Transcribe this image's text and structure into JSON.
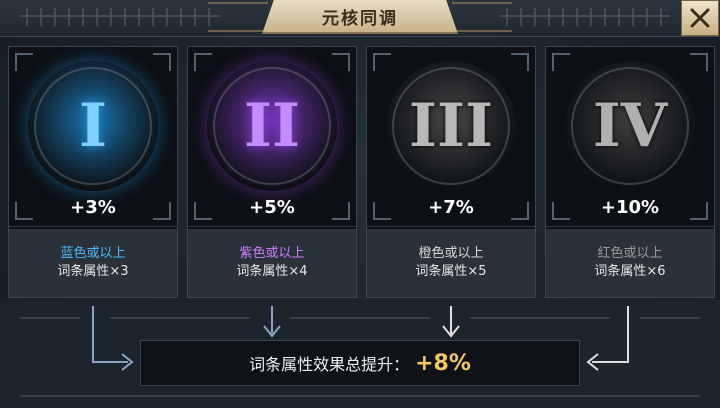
{
  "header": {
    "title": "元核同调",
    "close_icon": "close-x-icon"
  },
  "cards": [
    {
      "numeral": "I",
      "bonus": "+3%",
      "requirement": "蓝色或以上",
      "requirement_color": "#4ab8ff",
      "count": "词条属性×3",
      "orb_color": "#1e8fd8",
      "numeral_color": "#7fd0ff",
      "active": true
    },
    {
      "numeral": "II",
      "bonus": "+5%",
      "requirement": "紫色或以上",
      "requirement_color": "#c980ff",
      "count": "词条属性×4",
      "orb_color": "#8a3fd8",
      "numeral_color": "#c48cff",
      "active": true
    },
    {
      "numeral": "III",
      "bonus": "+7%",
      "requirement": "橙色或以上",
      "requirement_color": "#d8d8d8",
      "count": "词条属性×5",
      "orb_color": "#555555",
      "numeral_color": "#b8b8b8",
      "active": false
    },
    {
      "numeral": "IV",
      "bonus": "+10%",
      "requirement": "红色或以上",
      "requirement_color": "#9a9a9a",
      "count": "词条属性×6",
      "orb_color": "#4a4a4a",
      "numeral_color": "#b0b0b0",
      "active": false
    }
  ],
  "summary": {
    "label": "词条属性效果总提升：",
    "value": "+8%",
    "value_color": "#f3c66c"
  },
  "arrows": {
    "icons": [
      "connector-arrow-icon",
      "down-arrow-icon",
      "down-arrow-icon",
      "connector-arrow-icon"
    ]
  }
}
